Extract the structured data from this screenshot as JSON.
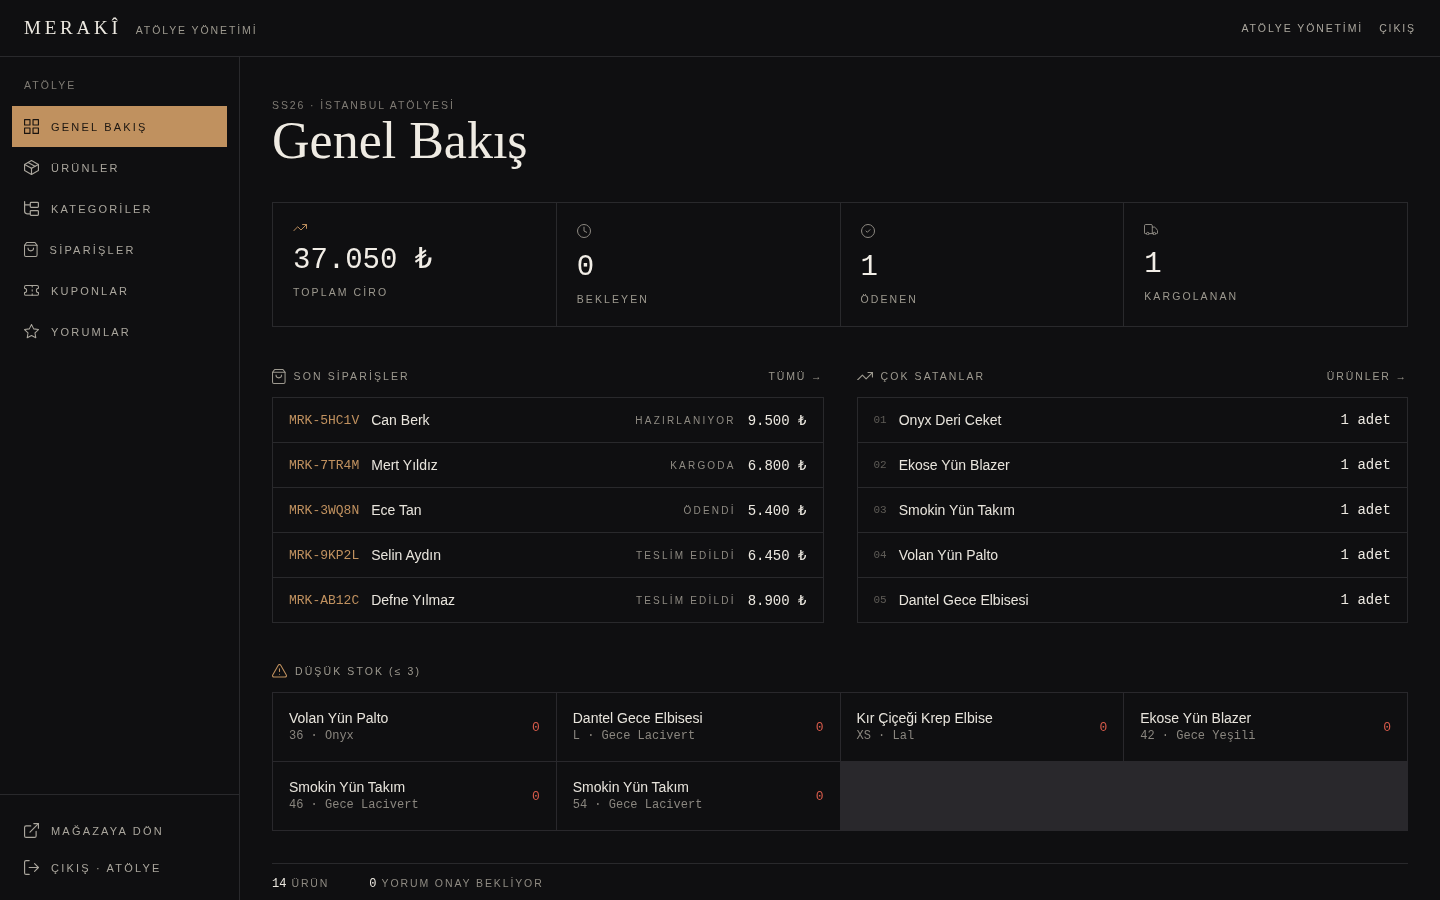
{
  "topbar": {
    "logo": "MERAKÎ",
    "subtitle": "ATÖLYE YÖNETİMİ",
    "links": [
      "ATÖLYE YÖNETİMİ",
      "ÇIKIŞ"
    ]
  },
  "sidebar": {
    "section_label": "ATÖLYE",
    "items": [
      {
        "kind": "overview",
        "label": "GENEL BAKIŞ",
        "selected": true
      },
      {
        "kind": "products",
        "label": "ÜRÜNLER",
        "selected": false
      },
      {
        "kind": "categories",
        "label": "KATEGORİLER",
        "selected": false
      },
      {
        "kind": "orders",
        "label": "SİPARİŞLER",
        "selected": false
      },
      {
        "kind": "coupons",
        "label": "KUPONLAR",
        "selected": false
      },
      {
        "kind": "reviews",
        "label": "YORUMLAR",
        "selected": false
      }
    ],
    "footer_items": [
      {
        "kind": "store",
        "label": "MAĞAZAYA DÖN"
      },
      {
        "kind": "logout",
        "label": "ÇIKIŞ · ATÖLYE"
      }
    ]
  },
  "page": {
    "eyebrow": "SS26 · İSTANBUL ATÖLYESİ",
    "title": "Genel Bakış"
  },
  "stats": [
    {
      "kind": "revenue",
      "value": "37.050 ₺",
      "label": "TOPLAM CİRO"
    },
    {
      "kind": "pending",
      "value": "0",
      "label": "BEKLEYEN"
    },
    {
      "kind": "paid",
      "value": "1",
      "label": "ÖDENEN"
    },
    {
      "kind": "shipped",
      "value": "1",
      "label": "KARGOLANAN"
    }
  ],
  "recent_orders": {
    "title": "SON SİPARİŞLER",
    "link": "TÜMÜ →",
    "rows": [
      {
        "code": "MRK-5HC1V",
        "customer": "Can Berk",
        "status": "HAZIRLANIYOR",
        "total": "9.500 ₺"
      },
      {
        "code": "MRK-7TR4M",
        "customer": "Mert Yıldız",
        "status": "KARGODA",
        "total": "6.800 ₺"
      },
      {
        "code": "MRK-3WQ8N",
        "customer": "Ece Tan",
        "status": "ÖDENDİ",
        "total": "5.400 ₺"
      },
      {
        "code": "MRK-9KP2L",
        "customer": "Selin Aydın",
        "status": "TESLİM EDİLDİ",
        "total": "6.450 ₺"
      },
      {
        "code": "MRK-AB12C",
        "customer": "Defne Yılmaz",
        "status": "TESLİM EDİLDİ",
        "total": "8.900 ₺"
      }
    ]
  },
  "best_sellers": {
    "title": "ÇOK SATANLAR",
    "link": "ÜRÜNLER →",
    "rows": [
      {
        "rank": "01",
        "name": "Onyx Deri Ceket",
        "quantity": "1 adet"
      },
      {
        "rank": "02",
        "name": "Ekose Yün Blazer",
        "quantity": "1 adet"
      },
      {
        "rank": "03",
        "name": "Smokin Yün Takım",
        "quantity": "1 adet"
      },
      {
        "rank": "04",
        "name": "Volan Yün Palto",
        "quantity": "1 adet"
      },
      {
        "rank": "05",
        "name": "Dantel Gece Elbisesi",
        "quantity": "1 adet"
      }
    ]
  },
  "low_stock": {
    "title": "DÜŞÜK STOK (≤ 3)",
    "items": [
      {
        "name": "Volan Yün Palto",
        "detail": "36 · Onyx",
        "stock": "0"
      },
      {
        "name": "Dantel Gece Elbisesi",
        "detail": "L · Gece Lacivert",
        "stock": "0"
      },
      {
        "name": "Kır Çiçeği Krep Elbise",
        "detail": "XS · Lal",
        "stock": "0"
      },
      {
        "name": "Ekose Yün Blazer",
        "detail": "42 · Gece Yeşili",
        "stock": "0"
      },
      {
        "name": "Smokin Yün Takım",
        "detail": "46 · Gece Lacivert",
        "stock": "0"
      },
      {
        "name": "Smokin Yün Takım",
        "detail": "54 · Gece Lacivert",
        "stock": "0"
      }
    ]
  },
  "footer_stats": [
    {
      "value": "14",
      "label": "ÜRÜN"
    },
    {
      "value": "0",
      "label": "YORUM ONAY BEKLİYOR"
    }
  ]
}
